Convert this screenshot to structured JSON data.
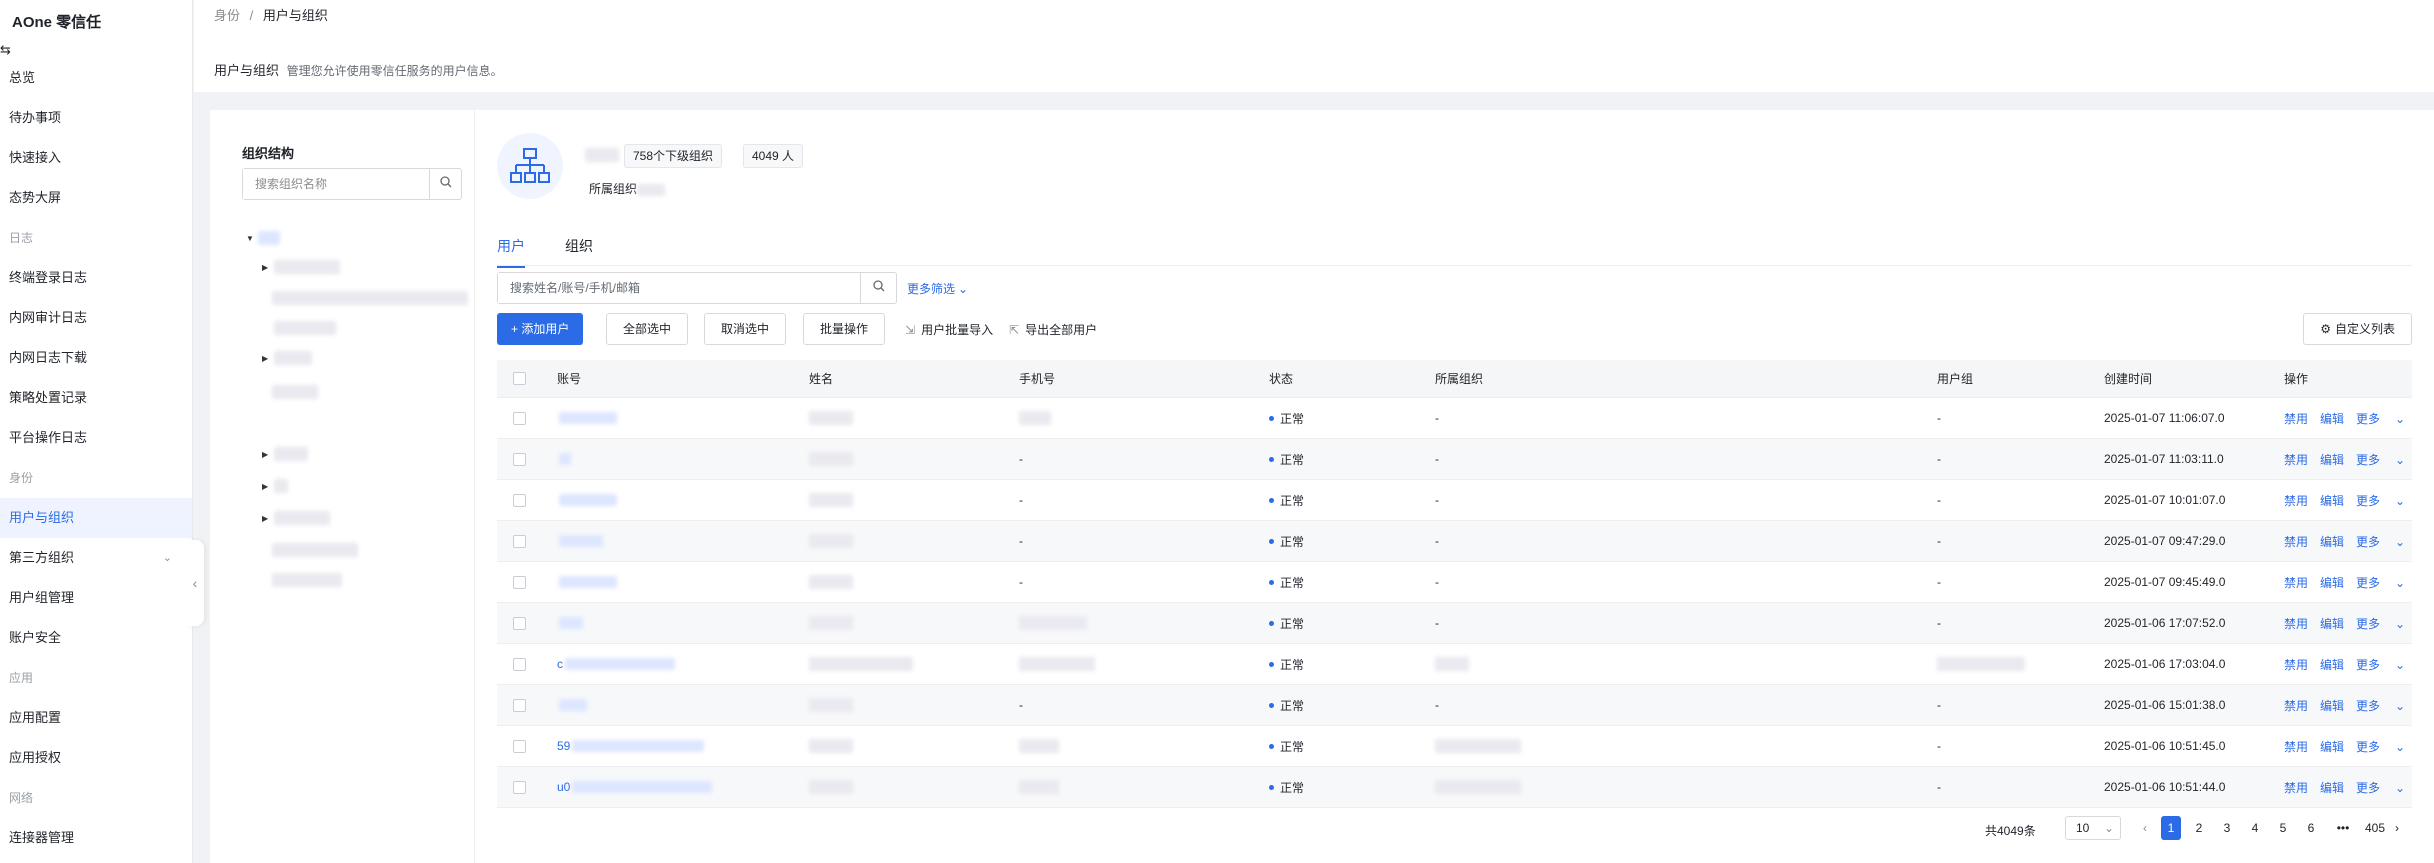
{
  "app": {
    "title": "AOne 零信任"
  },
  "sidebar": {
    "items": [
      {
        "label": "总览",
        "type": "item"
      },
      {
        "label": "待办事项",
        "type": "item"
      },
      {
        "label": "快速接入",
        "type": "item"
      },
      {
        "label": "态势大屏",
        "type": "item"
      },
      {
        "label": "日志",
        "type": "group"
      },
      {
        "label": "终端登录日志",
        "type": "item"
      },
      {
        "label": "内网审计日志",
        "type": "item"
      },
      {
        "label": "内网日志下载",
        "type": "item"
      },
      {
        "label": "策略处置记录",
        "type": "item"
      },
      {
        "label": "平台操作日志",
        "type": "item"
      },
      {
        "label": "身份",
        "type": "group"
      },
      {
        "label": "用户与组织",
        "type": "item",
        "active": true
      },
      {
        "label": "第三方组织",
        "type": "item",
        "chevron": true
      },
      {
        "label": "用户组管理",
        "type": "item"
      },
      {
        "label": "账户安全",
        "type": "item"
      },
      {
        "label": "应用",
        "type": "group"
      },
      {
        "label": "应用配置",
        "type": "item"
      },
      {
        "label": "应用授权",
        "type": "item"
      },
      {
        "label": "网络",
        "type": "group"
      },
      {
        "label": "连接器管理",
        "type": "item"
      }
    ]
  },
  "breadcrumb": {
    "parent": "身份",
    "sep": "/",
    "current": "用户与组织"
  },
  "header": {
    "title": "用户与组织",
    "description": "管理您允许使用零信任服务的用户信息。"
  },
  "org_panel": {
    "title": "组织结构",
    "search_placeholder": "搜索组织名称"
  },
  "org_info": {
    "sub_org_count": "758个下级组织",
    "member_count": "4049 人",
    "parent_label": "所属组织"
  },
  "tabs": [
    {
      "label": "用户",
      "active": true
    },
    {
      "label": "组织",
      "active": false
    }
  ],
  "toolbar": {
    "search_placeholder": "搜索姓名/账号/手机/邮箱",
    "more_filter": "更多筛选",
    "add_user": "+ 添加用户",
    "select_all": "全部选中",
    "deselect": "取消选中",
    "batch": "批量操作",
    "import": "用户批量导入",
    "export": "导出全部用户",
    "custom_columns": "自定义列表"
  },
  "table": {
    "headers": [
      "账号",
      "姓名",
      "手机号",
      "状态",
      "所属组织",
      "用户组",
      "创建时间",
      "操作"
    ],
    "rows": [
      {
        "account": "",
        "phone": "",
        "status": "正常",
        "org": "-",
        "group": "-",
        "created": "2025-01-07 11:06:07.0"
      },
      {
        "account": "",
        "phone": "-",
        "status": "正常",
        "org": "-",
        "group": "-",
        "created": "2025-01-07 11:03:11.0"
      },
      {
        "account": "",
        "phone": "-",
        "status": "正常",
        "org": "-",
        "group": "-",
        "created": "2025-01-07 10:01:07.0"
      },
      {
        "account": "",
        "phone": "-",
        "status": "正常",
        "org": "-",
        "group": "-",
        "created": "2025-01-07 09:47:29.0"
      },
      {
        "account": "",
        "phone": "-",
        "status": "正常",
        "org": "-",
        "group": "-",
        "created": "2025-01-07 09:45:49.0"
      },
      {
        "account": "",
        "phone": "",
        "status": "正常",
        "org": "-",
        "group": "-",
        "created": "2025-01-06 17:07:52.0"
      },
      {
        "account": "c",
        "phone": "",
        "status": "正常",
        "org": "",
        "group": "",
        "created": "2025-01-06 17:03:04.0"
      },
      {
        "account": "",
        "phone": "-",
        "status": "正常",
        "org": "-",
        "group": "-",
        "created": "2025-01-06 15:01:38.0"
      },
      {
        "account": "59",
        "phone": "",
        "status": "正常",
        "org": "",
        "group": "-",
        "created": "2025-01-06 10:51:45.0"
      },
      {
        "account": "u0",
        "phone": "",
        "status": "正常",
        "org": "",
        "group": "-",
        "created": "2025-01-06 10:51:44.0"
      }
    ],
    "ops": {
      "disable": "禁用",
      "edit": "编辑",
      "more": "更多"
    }
  },
  "pagination": {
    "total": "共4049条",
    "page_size": "10",
    "pages": [
      "1",
      "2",
      "3",
      "4",
      "5",
      "6",
      "•••",
      "405"
    ],
    "current": "1"
  },
  "colors": {
    "accent": "#2b6be6",
    "bg": "#f0f2f5"
  }
}
